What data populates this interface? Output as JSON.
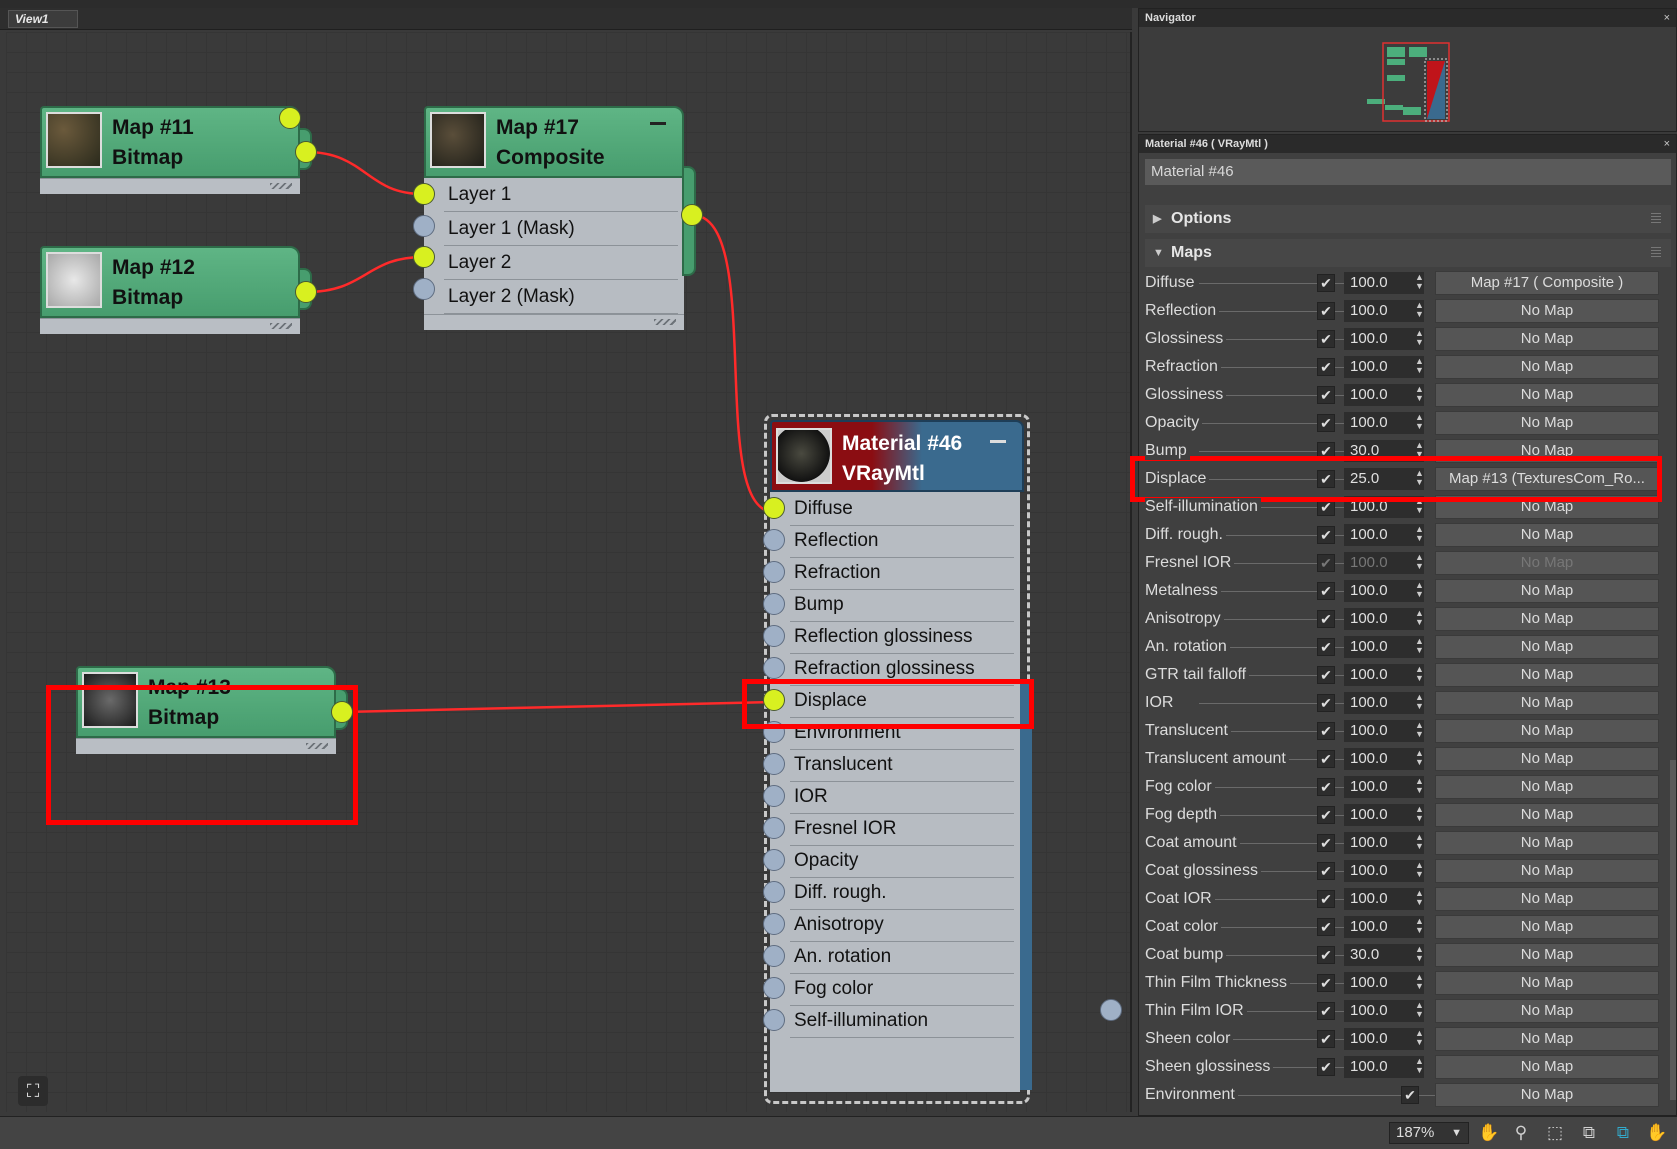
{
  "view": {
    "tab": "View1"
  },
  "nodes": {
    "map11": {
      "title": "Map #11",
      "type": "Bitmap"
    },
    "map12": {
      "title": "Map #12",
      "type": "Bitmap"
    },
    "map17": {
      "title": "Map #17",
      "type": "Composite",
      "slots": [
        "Layer 1",
        "Layer 1 (Mask)",
        "Layer 2",
        "Layer 2 (Mask)"
      ]
    },
    "map13": {
      "title": "Map #13",
      "type": "Bitmap"
    },
    "mat46": {
      "title": "Material #46",
      "type": "VRayMtl",
      "slots": [
        "Diffuse",
        "Reflection",
        "Refraction",
        "Bump",
        "Reflection glossiness",
        "Refraction glossiness",
        "Displace",
        "Environment",
        "Translucent",
        "IOR",
        "Fresnel IOR",
        "Opacity",
        "Diff. rough.",
        "Anisotropy",
        "An. rotation",
        "Fog color",
        "Self-illumination"
      ]
    }
  },
  "navigator": {
    "title": "Navigator"
  },
  "material_panel": {
    "title": "Material #46  ( VRayMtl )",
    "name": "Material #46",
    "rollouts": {
      "options": "Options",
      "maps": "Maps"
    },
    "maps": [
      {
        "label": "Diffuse",
        "value": "100.0",
        "map": "Map #17  ( Composite )"
      },
      {
        "label": "Reflection",
        "value": "100.0",
        "map": "No Map"
      },
      {
        "label": "Glossiness",
        "value": "100.0",
        "map": "No Map"
      },
      {
        "label": "Refraction",
        "value": "100.0",
        "map": "No Map"
      },
      {
        "label": "Glossiness",
        "value": "100.0",
        "map": "No Map"
      },
      {
        "label": "Opacity",
        "value": "100.0",
        "map": "No Map"
      },
      {
        "label": "Bump",
        "value": "30.0",
        "map": "No Map"
      },
      {
        "label": "Displace",
        "value": "25.0",
        "map": "Map #13 (TexturesCom_Ro..."
      },
      {
        "label": "Self-illumination",
        "value": "100.0",
        "map": "No Map"
      },
      {
        "label": "Diff. rough.",
        "value": "100.0",
        "map": "No Map"
      },
      {
        "label": "Fresnel IOR",
        "value": "100.0",
        "map": "No Map"
      },
      {
        "label": "Metalness",
        "value": "100.0",
        "map": "No Map"
      },
      {
        "label": "Anisotropy",
        "value": "100.0",
        "map": "No Map"
      },
      {
        "label": "An. rotation",
        "value": "100.0",
        "map": "No Map"
      },
      {
        "label": "GTR tail falloff",
        "value": "100.0",
        "map": "No Map"
      },
      {
        "label": "IOR",
        "value": "100.0",
        "map": "No Map"
      },
      {
        "label": "Translucent",
        "value": "100.0",
        "map": "No Map"
      },
      {
        "label": "Translucent amount",
        "value": "100.0",
        "map": "No Map"
      },
      {
        "label": "Fog color",
        "value": "100.0",
        "map": "No Map"
      },
      {
        "label": "Fog depth",
        "value": "100.0",
        "map": "No Map"
      },
      {
        "label": "Coat amount",
        "value": "100.0",
        "map": "No Map"
      },
      {
        "label": "Coat glossiness",
        "value": "100.0",
        "map": "No Map"
      },
      {
        "label": "Coat IOR",
        "value": "100.0",
        "map": "No Map"
      },
      {
        "label": "Coat color",
        "value": "100.0",
        "map": "No Map"
      },
      {
        "label": "Coat bump",
        "value": "30.0",
        "map": "No Map"
      },
      {
        "label": "Thin Film Thickness",
        "value": "100.0",
        "map": "No Map"
      },
      {
        "label": "Thin Film IOR",
        "value": "100.0",
        "map": "No Map"
      },
      {
        "label": "Sheen color",
        "value": "100.0",
        "map": "No Map"
      },
      {
        "label": "Sheen glossiness",
        "value": "100.0",
        "map": "No Map"
      },
      {
        "label": "Environment",
        "value": "",
        "map": "No Map"
      }
    ]
  },
  "status": {
    "zoom": "187%"
  },
  "colors": {
    "node_green": "#479d6e",
    "material_header": "#8b0d12",
    "wire": "#ff2a2a",
    "highlight": "#ff0000",
    "socket_active": "#d8f020"
  }
}
